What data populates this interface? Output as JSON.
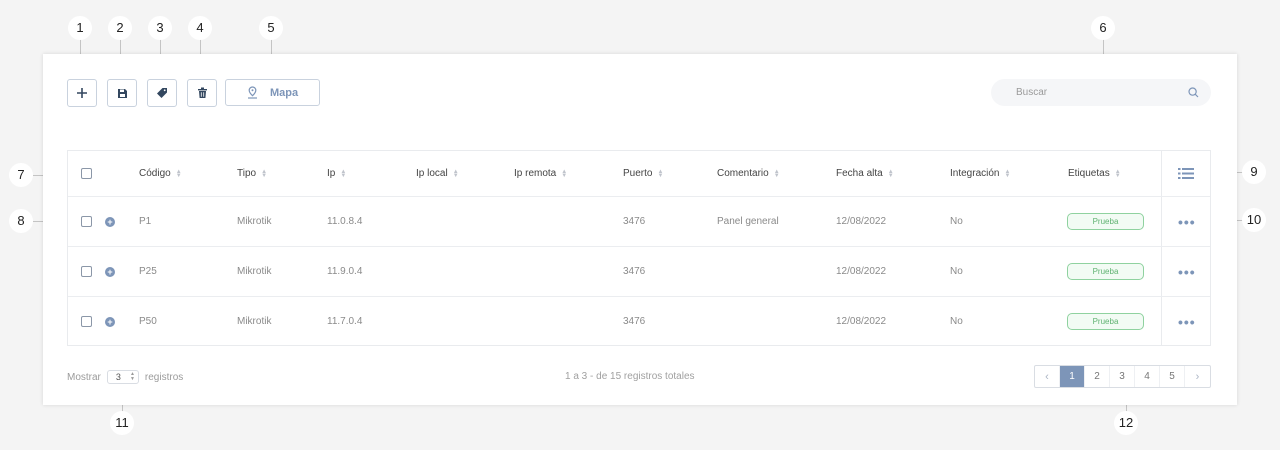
{
  "callouts": [
    "1",
    "2",
    "3",
    "4",
    "5",
    "6",
    "7",
    "8",
    "9",
    "10",
    "11",
    "12"
  ],
  "toolbar": {
    "add_icon": "plus-icon",
    "save_icon": "floppy-disk-icon",
    "tag_icon": "tag-icon",
    "delete_icon": "trash-icon",
    "map_icon": "map-pin-icon",
    "map_label": "Mapa"
  },
  "search": {
    "placeholder": "Buscar",
    "icon": "search-icon"
  },
  "table": {
    "columns": [
      "Código",
      "Tipo",
      "Ip",
      "Ip local",
      "Ip remota",
      "Puerto",
      "Comentario",
      "Fecha alta",
      "Integración",
      "Etiquetas"
    ],
    "column_menu_icon": "list-icon",
    "rows": [
      {
        "codigo": "P1",
        "tipo": "Mikrotik",
        "ip": "11.0.8.4",
        "ip_local": "",
        "ip_remota": "",
        "puerto": "3476",
        "comentario": "Panel general",
        "fecha_alta": "12/08/2022",
        "integracion": "No",
        "etiqueta": "Prueba"
      },
      {
        "codigo": "P25",
        "tipo": "Mikrotik",
        "ip": "11.9.0.4",
        "ip_local": "",
        "ip_remota": "",
        "puerto": "3476",
        "comentario": "",
        "fecha_alta": "12/08/2022",
        "integracion": "No",
        "etiqueta": "Prueba"
      },
      {
        "codigo": "P50",
        "tipo": "Mikrotik",
        "ip": "11.7.0.4",
        "ip_local": "",
        "ip_remota": "",
        "puerto": "3476",
        "comentario": "",
        "fecha_alta": "12/08/2022",
        "integracion": "No",
        "etiqueta": "Prueba"
      }
    ],
    "row_actions_icon": "more-horizontal-icon",
    "expand_icon": "plus-circle-icon"
  },
  "footer": {
    "show_label": "Mostrar",
    "page_size": "3",
    "records_label": "registros",
    "summary": "1 a 3 - de 15 registros totales",
    "pages": [
      "1",
      "2",
      "3",
      "4",
      "5"
    ],
    "active_page": "1",
    "prev_icon": "chevron-left-icon",
    "next_icon": "chevron-right-icon"
  },
  "colors": {
    "accent": "#7d95b8",
    "tag_border": "#8fd29f",
    "tag_text": "#5fb271"
  }
}
